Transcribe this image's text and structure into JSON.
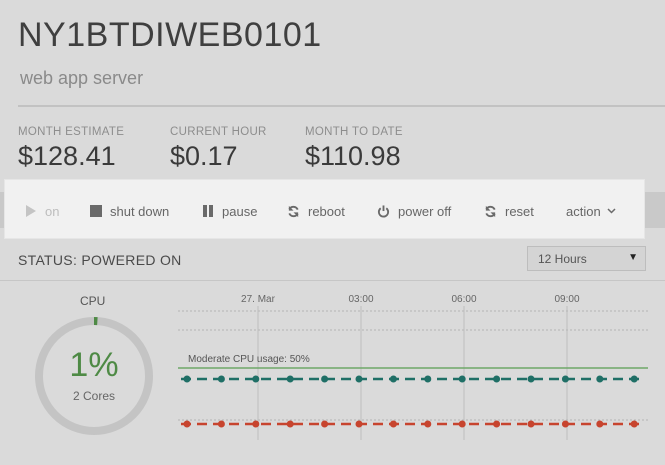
{
  "server": {
    "name": "NY1BTDIWEB0101",
    "description": "web app server"
  },
  "costs": [
    {
      "label": "MONTH ESTIMATE",
      "value": "$128.41"
    },
    {
      "label": "CURRENT HOUR",
      "value": "$0.17"
    },
    {
      "label": "MONTH TO DATE",
      "value": "$110.98"
    }
  ],
  "toolbar": {
    "on": "on",
    "shut_down": "shut down",
    "pause": "pause",
    "reboot": "reboot",
    "power_off": "power off",
    "reset": "reset",
    "action": "action"
  },
  "status": {
    "text": "STATUS: POWERED ON"
  },
  "range_select": {
    "value": "12 Hours"
  },
  "cpu": {
    "label": "CPU",
    "usage": "1%",
    "cores": "2 Cores",
    "usage_fraction": 0.01
  },
  "chart": {
    "x_ticks": [
      "27. Mar",
      "03:00",
      "06:00",
      "09:00"
    ],
    "annotation": "Moderate CPU usage: 50%"
  },
  "colors": {
    "usage_ok": "#4e8a45",
    "series_teal": "#1f6f66",
    "series_red": "#c7442e",
    "threshold_green": "#6ea868"
  }
}
